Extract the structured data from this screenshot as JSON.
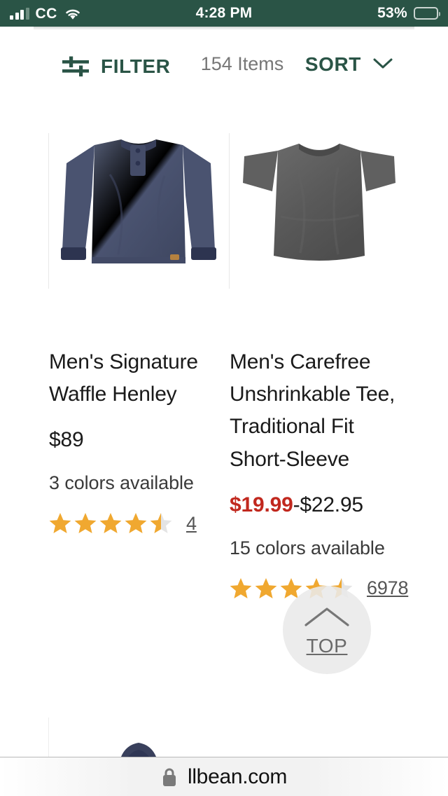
{
  "status_bar": {
    "carrier_icon": "signal-bars-icon",
    "cc_label": "CC",
    "wifi_icon": "wifi-icon",
    "time": "4:28 PM",
    "battery_percent": "53%",
    "battery_icon": "battery-icon",
    "background_color": "#2a5446",
    "text_color": "#ffffff"
  },
  "toolbar": {
    "filter_icon": "filter-sliders-icon",
    "filter_label": "FILTER",
    "item_count": "154 Items",
    "sort_label": "SORT",
    "sort_chevron_icon": "chevron-down-icon",
    "accent_color": "#2a5446",
    "count_color": "#777777"
  },
  "products": [
    {
      "image_alt": "navy long-sleeve waffle henley shirt",
      "title": "Men's Signature Waffle Henley",
      "price": "$89",
      "price_sale": "",
      "price_regular": "$89",
      "colors": "3 colors available",
      "rating": 4.5,
      "review_count": "4"
    },
    {
      "image_alt": "charcoal gray short-sleeve tee",
      "title": "Men's Carefree Unshrinkable Tee, Traditional Fit Short-Sleeve",
      "price": "$19.99-$22.95",
      "price_sale": "$19.99",
      "price_regular": "-$22.95",
      "colors": "15 colors available",
      "rating": 4.5,
      "review_count": "6978"
    }
  ],
  "scroll_top_button": {
    "label": "TOP",
    "arrow_icon": "chevron-up-icon"
  },
  "browser_bar": {
    "lock_icon": "lock-icon",
    "url": "llbean.com"
  },
  "colors": {
    "brand_green": "#2a5446",
    "sale_red": "#c1281e",
    "star_gold": "#f0a830",
    "star_empty": "#e4e4e4"
  }
}
